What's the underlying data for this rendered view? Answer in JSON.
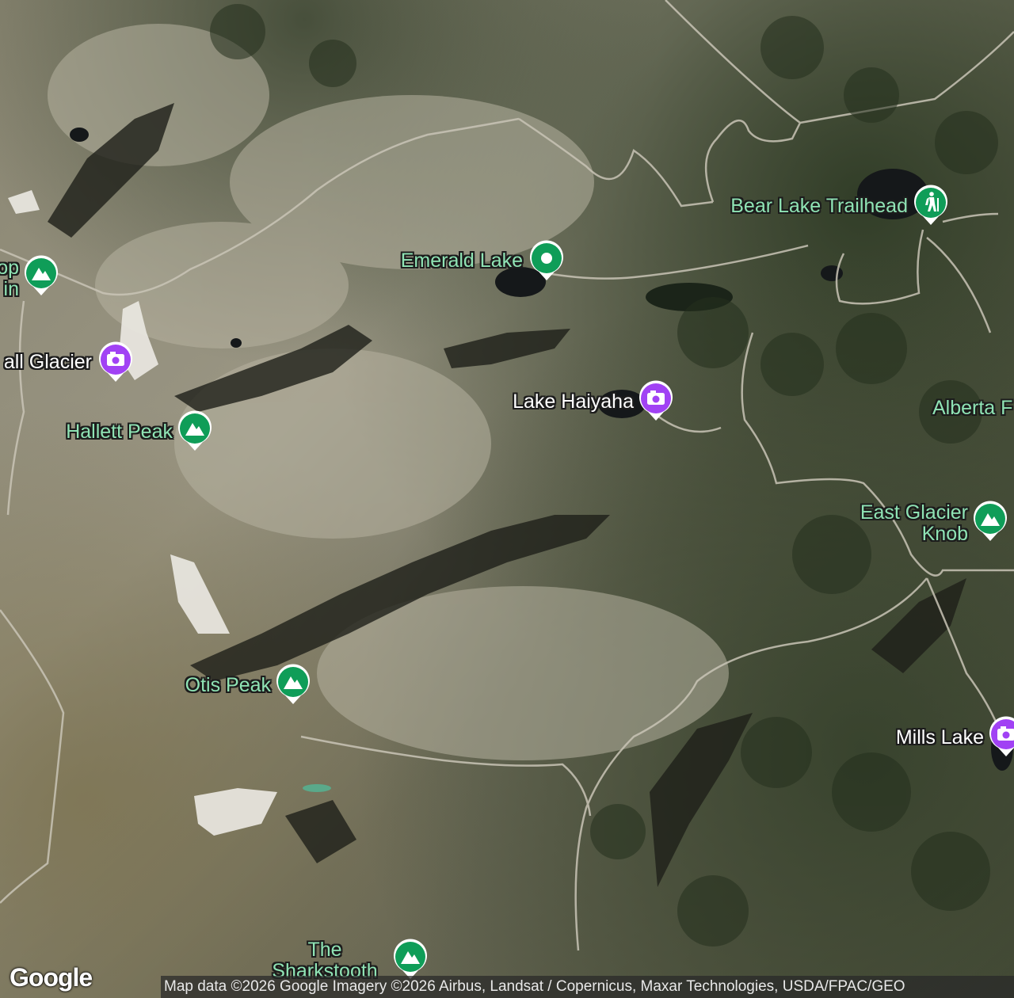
{
  "map": {
    "type": "satellite",
    "colors": {
      "nature_pin": "#0f9d58",
      "photo_pin": "#a142f4",
      "trail_line": "#c9c4b6",
      "label_green": "#8fe3b4"
    }
  },
  "pois": {
    "flattop_partial": {
      "name": "op\nin",
      "icon": "mountain-icon"
    },
    "tyndall_partial": {
      "name": "all Glacier",
      "icon": "camera-icon"
    },
    "hallett": {
      "name": "Hallett Peak",
      "icon": "mountain-icon"
    },
    "emerald": {
      "name": "Emerald Lake",
      "icon": "location-dot-icon"
    },
    "bear": {
      "name": "Bear Lake Trailhead",
      "icon": "hiker-icon"
    },
    "haiyaha": {
      "name": "Lake Haiyaha",
      "icon": "camera-icon"
    },
    "alberta": {
      "name": "Alberta F"
    },
    "eastglacier": {
      "name": "East Glacier\nKnob",
      "icon": "mountain-icon"
    },
    "otis": {
      "name": "Otis Peak",
      "icon": "mountain-icon"
    },
    "mills": {
      "name": "Mills Lake",
      "icon": "camera-icon"
    },
    "sharkstooth": {
      "name": "The\nSharkstooth",
      "icon": "mountain-icon"
    }
  },
  "footer": {
    "logo": "Google",
    "attribution": "Map data ©2026 Google Imagery ©2026 Airbus, Landsat / Copernicus, Maxar Technologies, USDA/FPAC/GEO"
  }
}
